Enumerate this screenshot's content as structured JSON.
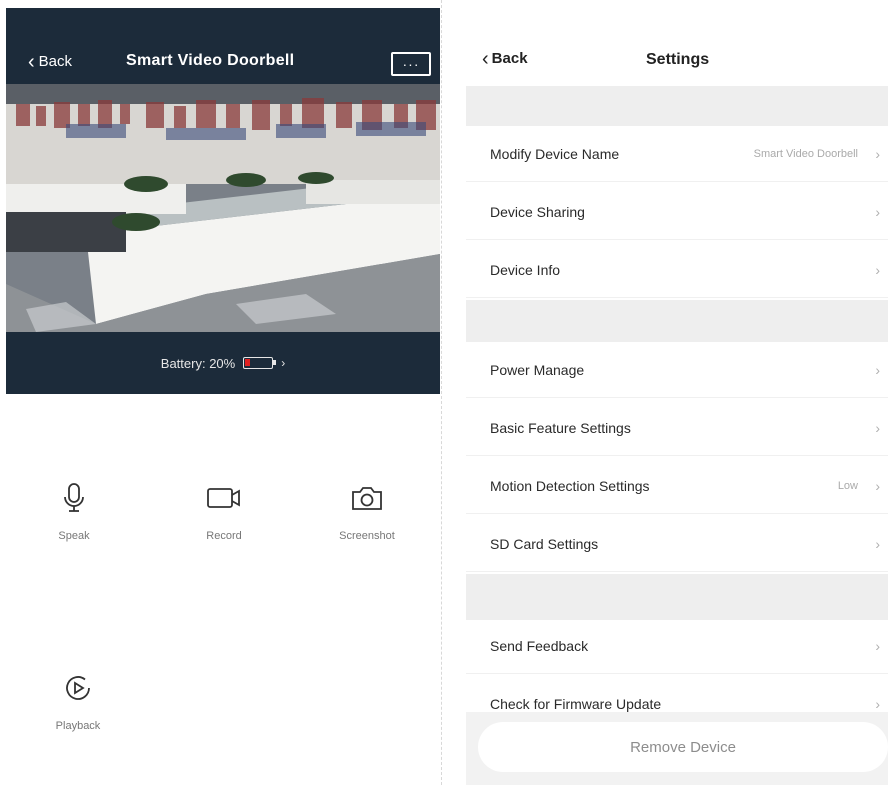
{
  "camera": {
    "back_label": "Back",
    "title": "Smart Video Doorbell",
    "more_label": "···",
    "battery_text": "Battery: 20%",
    "battery_level": 0.2,
    "battery_color": "#e02020",
    "header_color": "#1c2b3a",
    "actions": [
      {
        "label": "Speak",
        "icon": "microphone-icon"
      },
      {
        "label": "Record",
        "icon": "video-camera-icon"
      },
      {
        "label": "Screenshot",
        "icon": "camera-icon"
      },
      {
        "label": "Playback",
        "icon": "play-circle-icon"
      }
    ]
  },
  "settings": {
    "back_label": "Back",
    "title": "Settings",
    "rows": [
      {
        "label": "Modify Device Name",
        "value": "Smart Video Doorbell"
      },
      {
        "label": "Device Sharing",
        "value": ""
      },
      {
        "label": "Device Info",
        "value": ""
      },
      {
        "label": "Power Manage",
        "value": ""
      },
      {
        "label": "Basic Feature Settings",
        "value": ""
      },
      {
        "label": "Motion Detection Settings",
        "value": "Low"
      },
      {
        "label": "SD Card Settings",
        "value": ""
      },
      {
        "label": "Send Feedback",
        "value": ""
      },
      {
        "label": "Check for Firmware Update",
        "value": ""
      }
    ],
    "chevron": "›",
    "remove_label": "Remove Device"
  }
}
